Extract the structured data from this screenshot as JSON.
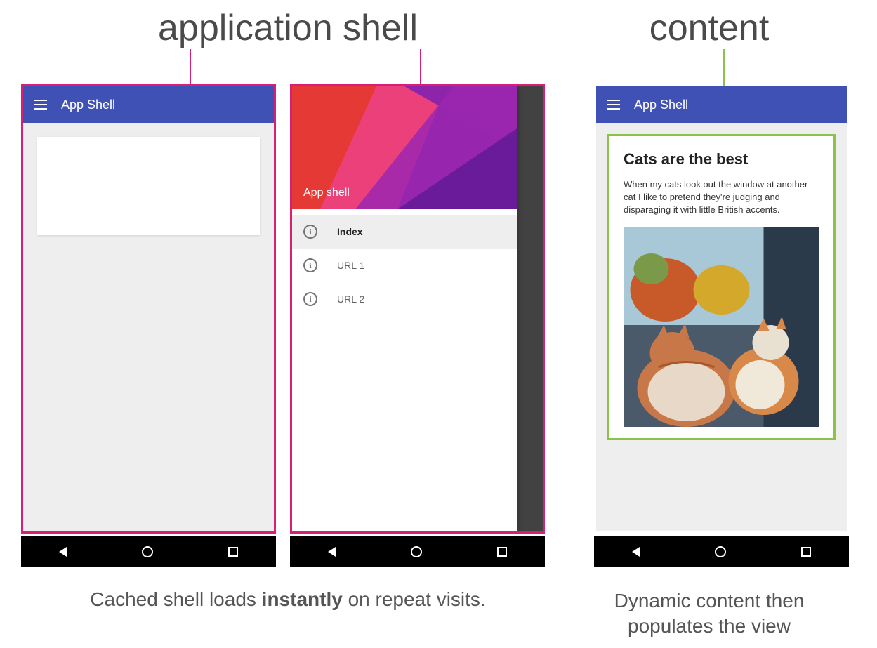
{
  "headers": {
    "shell": "application shell",
    "content": "content"
  },
  "panel1": {
    "app_title": "App Shell"
  },
  "panel2": {
    "drawer_title": "App shell",
    "items": [
      {
        "label": "Index",
        "active": true
      },
      {
        "label": "URL 1",
        "active": false
      },
      {
        "label": "URL 2",
        "active": false
      }
    ]
  },
  "panel3": {
    "app_title": "App Shell",
    "content_title": "Cats are the best",
    "content_body": "When my cats look out the window at another cat I like to pretend they're judging and disparaging it with little British accents."
  },
  "captions": {
    "left_pre": "Cached shell loads ",
    "left_bold": "instantly",
    "left_post": " on repeat visits.",
    "right": "Dynamic content then populates the view"
  },
  "colors": {
    "pink": "#d91e76",
    "green": "#8bc34a",
    "appbar": "#3f51b5"
  }
}
